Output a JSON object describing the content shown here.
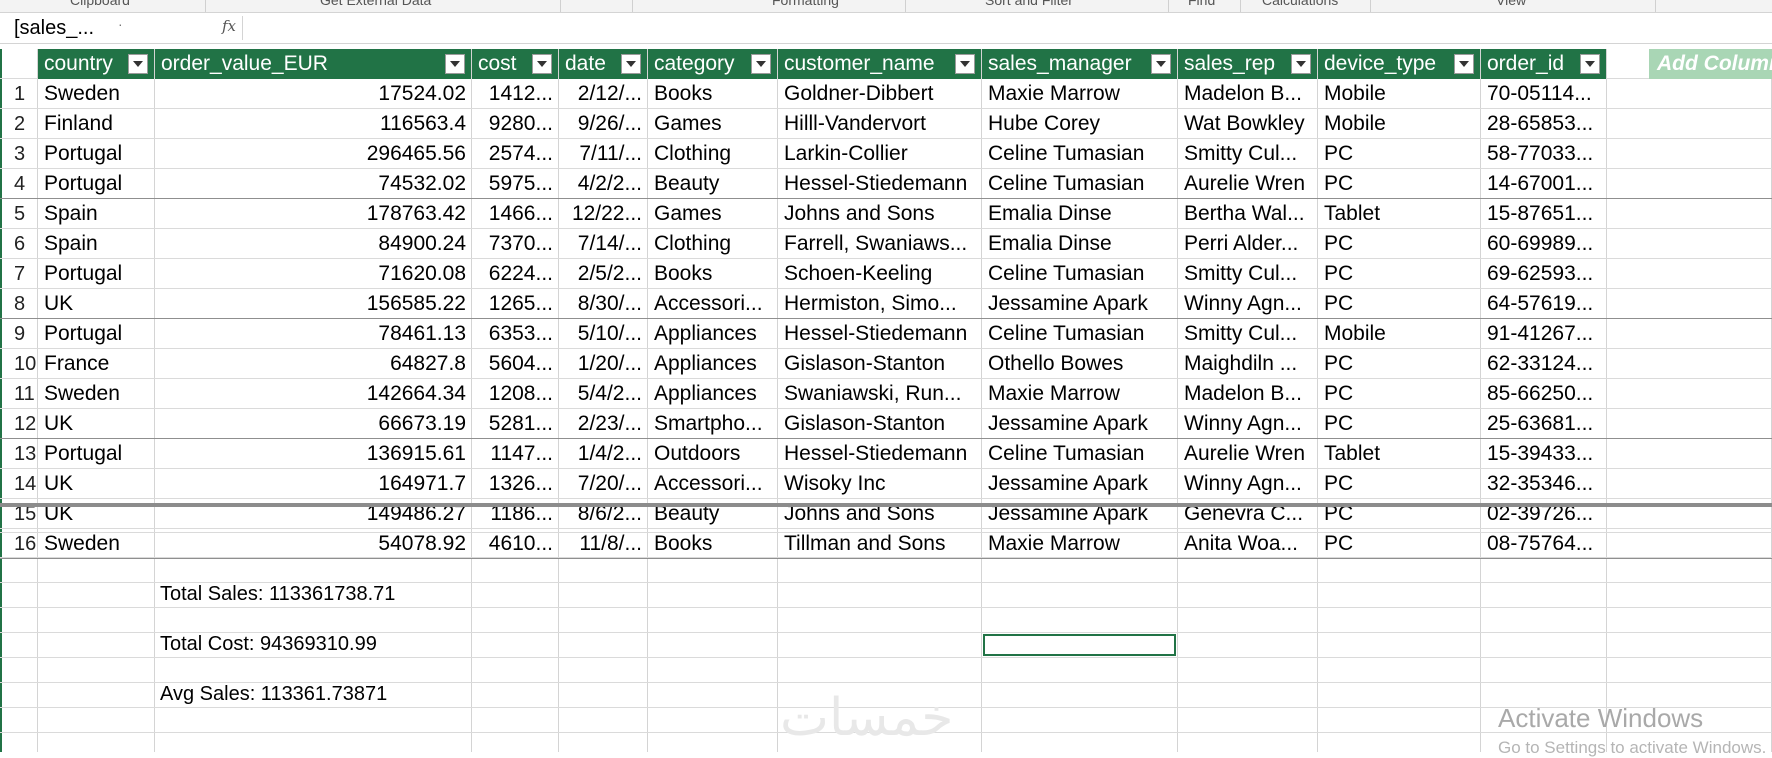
{
  "ribbon": {
    "groups": [
      "Clipboard",
      "Get External Data",
      "Formatting",
      "Sort and Filter",
      "Find",
      "Calculations",
      "View"
    ]
  },
  "formula_bar": {
    "name_box": "[sales_...",
    "fx_label": "fx",
    "formula": ""
  },
  "table": {
    "columns": [
      "country",
      "order_value_EUR",
      "cost",
      "date",
      "category",
      "customer_name",
      "sales_manager",
      "sales_rep",
      "device_type",
      "order_id"
    ],
    "add_column_label": "Add Column",
    "rows": [
      {
        "n": "1",
        "country": "Sweden",
        "order_value_EUR": "17524.02",
        "cost": "1412...",
        "date": "2/12/...",
        "category": "Books",
        "customer_name": "Goldner-Dibbert",
        "sales_manager": "Maxie Marrow",
        "sales_rep": "Madelon B...",
        "device_type": "Mobile",
        "order_id": "70-05114..."
      },
      {
        "n": "2",
        "country": "Finland",
        "order_value_EUR": "116563.4",
        "cost": "9280...",
        "date": "9/26/...",
        "category": "Games",
        "customer_name": "Hilll-Vandervort",
        "sales_manager": "Hube Corey",
        "sales_rep": "Wat Bowkley",
        "device_type": "Mobile",
        "order_id": "28-65853..."
      },
      {
        "n": "3",
        "country": "Portugal",
        "order_value_EUR": "296465.56",
        "cost": "2574...",
        "date": "7/11/...",
        "category": "Clothing",
        "customer_name": "Larkin-Collier",
        "sales_manager": "Celine Tumasian",
        "sales_rep": "Smitty Cul...",
        "device_type": "PC",
        "order_id": "58-77033..."
      },
      {
        "n": "4",
        "country": "Portugal",
        "order_value_EUR": "74532.02",
        "cost": "5975...",
        "date": "4/2/2...",
        "category": "Beauty",
        "customer_name": "Hessel-Stiedemann",
        "sales_manager": "Celine Tumasian",
        "sales_rep": "Aurelie Wren",
        "device_type": "PC",
        "order_id": "14-67001..."
      },
      {
        "n": "5",
        "country": "Spain",
        "order_value_EUR": "178763.42",
        "cost": "1466...",
        "date": "12/22...",
        "category": "Games",
        "customer_name": "Johns and Sons",
        "sales_manager": "Emalia Dinse",
        "sales_rep": "Bertha Wal...",
        "device_type": "Tablet",
        "order_id": "15-87651..."
      },
      {
        "n": "6",
        "country": "Spain",
        "order_value_EUR": "84900.24",
        "cost": "7370...",
        "date": "7/14/...",
        "category": "Clothing",
        "customer_name": "Farrell, Swaniaws...",
        "sales_manager": "Emalia Dinse",
        "sales_rep": "Perri Alder...",
        "device_type": "PC",
        "order_id": "60-69989..."
      },
      {
        "n": "7",
        "country": "Portugal",
        "order_value_EUR": "71620.08",
        "cost": "6224...",
        "date": "2/5/2...",
        "category": "Books",
        "customer_name": "Schoen-Keeling",
        "sales_manager": "Celine Tumasian",
        "sales_rep": "Smitty Cul...",
        "device_type": "PC",
        "order_id": "69-62593..."
      },
      {
        "n": "8",
        "country": "UK",
        "order_value_EUR": "156585.22",
        "cost": "1265...",
        "date": "8/30/...",
        "category": "Accessori...",
        "customer_name": "Hermiston, Simo...",
        "sales_manager": "Jessamine Apark",
        "sales_rep": "Winny Agn...",
        "device_type": "PC",
        "order_id": "64-57619..."
      },
      {
        "n": "9",
        "country": "Portugal",
        "order_value_EUR": "78461.13",
        "cost": "6353...",
        "date": "5/10/...",
        "category": "Appliances",
        "customer_name": "Hessel-Stiedemann",
        "sales_manager": "Celine Tumasian",
        "sales_rep": "Smitty Cul...",
        "device_type": "Mobile",
        "order_id": "91-41267..."
      },
      {
        "n": "10",
        "country": "France",
        "order_value_EUR": "64827.8",
        "cost": "5604...",
        "date": "1/20/...",
        "category": "Appliances",
        "customer_name": "Gislason-Stanton",
        "sales_manager": "Othello Bowes",
        "sales_rep": "Maighdiln ...",
        "device_type": "PC",
        "order_id": "62-33124..."
      },
      {
        "n": "11",
        "country": "Sweden",
        "order_value_EUR": "142664.34",
        "cost": "1208...",
        "date": "5/4/2...",
        "category": "Appliances",
        "customer_name": "Swaniawski, Run...",
        "sales_manager": "Maxie Marrow",
        "sales_rep": "Madelon B...",
        "device_type": "PC",
        "order_id": "85-66250..."
      },
      {
        "n": "12",
        "country": "UK",
        "order_value_EUR": "66673.19",
        "cost": "5281...",
        "date": "2/23/...",
        "category": "Smartpho...",
        "customer_name": "Gislason-Stanton",
        "sales_manager": "Jessamine Apark",
        "sales_rep": "Winny Agn...",
        "device_type": "PC",
        "order_id": "25-63681..."
      },
      {
        "n": "13",
        "country": "Portugal",
        "order_value_EUR": "136915.61",
        "cost": "1147...",
        "date": "1/4/2...",
        "category": "Outdoors",
        "customer_name": "Hessel-Stiedemann",
        "sales_manager": "Celine Tumasian",
        "sales_rep": "Aurelie Wren",
        "device_type": "Tablet",
        "order_id": "15-39433..."
      },
      {
        "n": "14",
        "country": "UK",
        "order_value_EUR": "164971.7",
        "cost": "1326...",
        "date": "7/20/...",
        "category": "Accessori...",
        "customer_name": "Wisoky Inc",
        "sales_manager": "Jessamine Apark",
        "sales_rep": "Winny Agn...",
        "device_type": "PC",
        "order_id": "32-35346..."
      },
      {
        "n": "15",
        "country": "UK",
        "order_value_EUR": "149486.27",
        "cost": "1186...",
        "date": "8/6/2...",
        "category": "Beauty",
        "customer_name": "Johns and Sons",
        "sales_manager": "Jessamine Apark",
        "sales_rep": "Genevra C...",
        "device_type": "PC",
        "order_id": "02-39726..."
      },
      {
        "n": "16",
        "country": "Sweden",
        "order_value_EUR": "54078.92",
        "cost": "4610...",
        "date": "11/8/...",
        "category": "Books",
        "customer_name": "Tillman and Sons",
        "sales_manager": "Maxie Marrow",
        "sales_rep": "Anita Woa...",
        "device_type": "PC",
        "order_id": "08-75764..."
      }
    ]
  },
  "totals": {
    "total_sales": "Total  Sales: 113361738.71",
    "total_cost": "Total  Cost: 94369310.99",
    "avg_sales": "Avg  Sales: 113361.73871"
  },
  "overlay": {
    "watermark": "خمسات",
    "activate_title": "Activate Windows",
    "activate_sub": "Go to Settings to activate Windows."
  },
  "colors": {
    "header_green": "#217346",
    "add_column_green": "#a9d6b5"
  }
}
